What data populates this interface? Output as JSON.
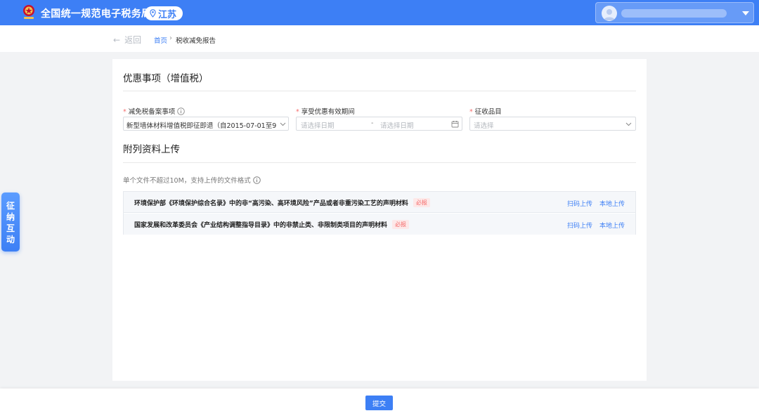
{
  "header": {
    "site_title": "全国统一规范电子税务局",
    "region": "江苏",
    "emblem_icon": "tax-emblem-icon",
    "user_menu_icon": "chevron-down-icon",
    "brand_color": "#3d7ff5"
  },
  "breadcrumb": {
    "back_label": "返回",
    "home": "首页",
    "separator": "›",
    "current": "税收减免报告"
  },
  "form": {
    "section_title": "优惠事项（增值税）",
    "fields": [
      {
        "label": "减免税备案事项",
        "required": true,
        "value": "新型墙体材料增值税即征即退（自2015-07-01至9..."
      },
      {
        "label": "享受优惠有效期间",
        "required": true,
        "start_placeholder": "请选择日期",
        "range_separator": "-",
        "end_placeholder": "请选择日期"
      },
      {
        "label": "征收品目",
        "required": true,
        "placeholder": "请选择"
      }
    ]
  },
  "attachments": {
    "section_title": "附列资料上传",
    "hint": "单个文件不超过10M，支持上传的文件格式",
    "required_badge": "必报",
    "rows": [
      {
        "name": "环境保护部《环境保护综合名录》中的非“高污染、高环境风险”产品或者非重污染工艺的声明材料",
        "scan_label": "扫码上传",
        "local_label": "本地上传"
      },
      {
        "name": "国家发展和改革委员会《产业结构调整指导目录》中的非禁止类、非限制类项目的声明材料",
        "scan_label": "扫码上传",
        "local_label": "本地上传"
      }
    ]
  },
  "side_float": {
    "label": "征纳互动"
  },
  "footer": {
    "submit_label": "提交"
  }
}
